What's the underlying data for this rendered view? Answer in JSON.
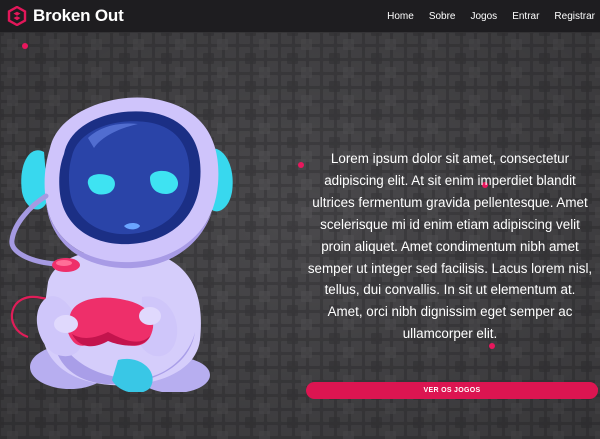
{
  "nav": {
    "brand": "Broken Out",
    "links": [
      "Home",
      "Sobre",
      "Jogos",
      "Entrar",
      "Registrar"
    ]
  },
  "hero": {
    "text": "Lorem ipsum dolor sit amet, consectetur adipiscing elit. At sit enim imperdiet blandit ultrices fermentum gravida pellentesque. Amet scelerisque mi id enim etiam adipiscing velit proin aliquet. Amet condimentum nibh amet semper ut integer sed facilisis. Lacus lorem nisl, tellus, dui convallis. In sit ut elementum at. Amet, orci nibh dignissim eget semper ac ullamcorper elit.",
    "cta_label": "VER OS JOGOS"
  },
  "colors": {
    "navbar": "#1e1d20",
    "background": "#414042",
    "accent": "#dc1551"
  },
  "icons": {
    "logo": "broken-out-logo-icon",
    "mascot": "robot-gamer-mascot"
  }
}
